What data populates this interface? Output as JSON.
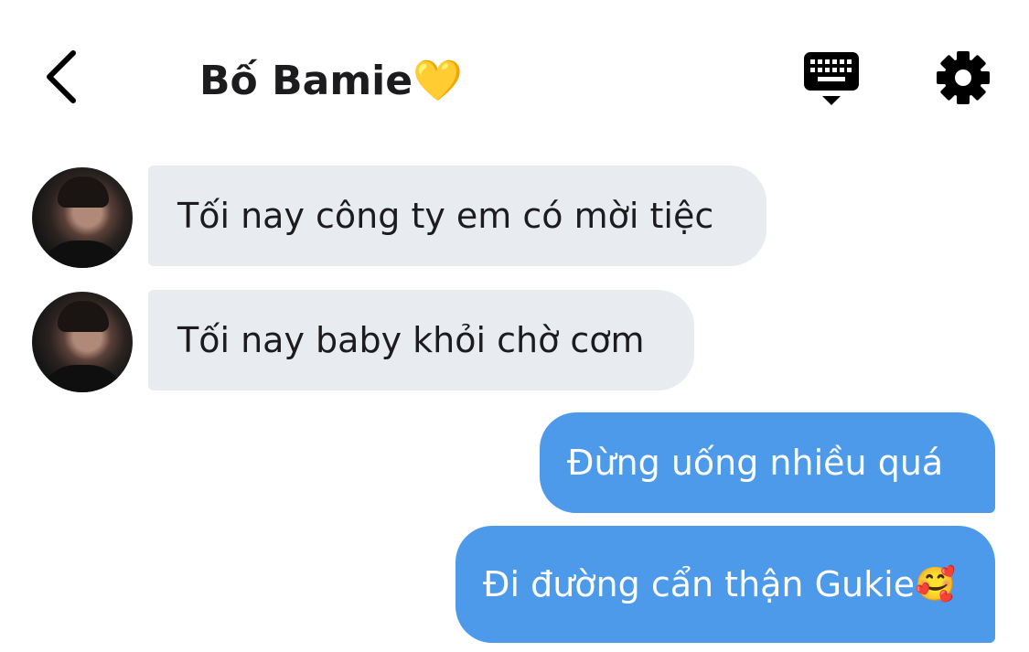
{
  "header": {
    "title": "Bố Bamie",
    "title_emoji": "💛",
    "icons": {
      "back": "chevron-left-icon",
      "keyboard": "keyboard-icon",
      "settings": "gear-icon"
    }
  },
  "messages": [
    {
      "direction": "incoming",
      "text": "Tối nay công ty em có mời tiệc"
    },
    {
      "direction": "incoming",
      "text": "Tối nay baby khỏi chờ cơm"
    },
    {
      "direction": "outgoing",
      "text": "Đừng uống nhiều quá"
    },
    {
      "direction": "outgoing",
      "text": "Đi đường cẩn thận Gukie",
      "emoji": "🥰"
    }
  ],
  "colors": {
    "incoming_bubble": "#e8ebf0",
    "outgoing_bubble": "#4c9ae9",
    "title_text": "#1c1c1e"
  }
}
